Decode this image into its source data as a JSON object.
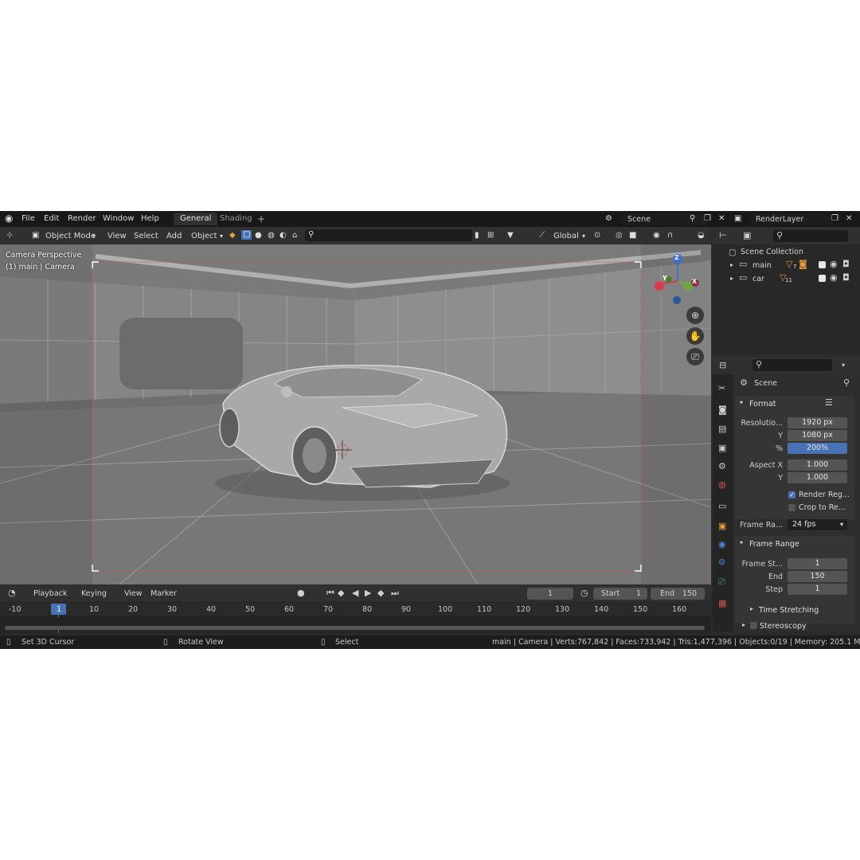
{
  "menu": {
    "items": [
      "File",
      "Edit",
      "Render",
      "Window",
      "Help"
    ],
    "workspaces": [
      "General",
      "Shading"
    ],
    "add_tab": "+",
    "scene": "Scene",
    "view_layer": "RenderLayer"
  },
  "viewport_header": {
    "mode": "Object Mode",
    "menus": [
      "View",
      "Select",
      "Add",
      "Object"
    ],
    "transform_orientation": "Global"
  },
  "viewport": {
    "view_name": "Camera Perspective",
    "view_context": "(1) main | Camera",
    "axis_labels": {
      "z": "Z",
      "y": "Y",
      "x": "X"
    }
  },
  "outliner": {
    "root": "Scene Collection",
    "collections": [
      {
        "name": "main",
        "badge": "7"
      },
      {
        "name": "car",
        "badge": "11"
      }
    ]
  },
  "properties": {
    "context": "Scene",
    "format_header": "Format",
    "resolution_x_label": "Resolutio...",
    "resolution_x": "1920 px",
    "resolution_y_label": "Y",
    "resolution_y": "1080 px",
    "percent_label": "%",
    "percent": "200%",
    "percent_fraction": 2.0,
    "aspect_x_label": "Aspect X",
    "aspect_x": "1.000",
    "aspect_y_label": "Y",
    "aspect_y": "1.000",
    "render_region": "Render Reg...",
    "crop_region": "Crop to Re...",
    "frame_rate_label": "Frame Ra...",
    "frame_rate": "24 fps",
    "frame_range_header": "Frame Range",
    "frame_start_label": "Frame St...",
    "frame_start": "1",
    "frame_end_label": "End",
    "frame_end": "150",
    "frame_step_label": "Step",
    "frame_step": "1",
    "time_stretching": "Time Stretching",
    "stereoscopy": "Stereoscopy"
  },
  "timeline": {
    "menus": [
      "Playback",
      "Keying",
      "View",
      "Marker"
    ],
    "current_frame": "1",
    "start_label": "Start",
    "start": "1",
    "end_label": "End",
    "end": "150",
    "ticks": [
      "-10",
      "1",
      "10",
      "20",
      "30",
      "40",
      "50",
      "60",
      "70",
      "80",
      "90",
      "100",
      "110",
      "120",
      "130",
      "140",
      "150",
      "160"
    ]
  },
  "statusbar": {
    "left_action": "Set 3D Cursor",
    "middle_action": "Rotate View",
    "right_action": "Select",
    "stats": "main | Camera | Verts:767,842 | Faces:733,942 | Tris:1,477,396 | Objects:0/19 | Memory: 205.1 MiB | V"
  },
  "colors": {
    "accent": "#4772b3",
    "menubar": "#181818",
    "panel": "#2e2e2e",
    "viewport": "#6f6f6f",
    "axis_x": "#d63b4f",
    "axis_y": "#6ea83a",
    "axis_z": "#3c6fd0"
  }
}
